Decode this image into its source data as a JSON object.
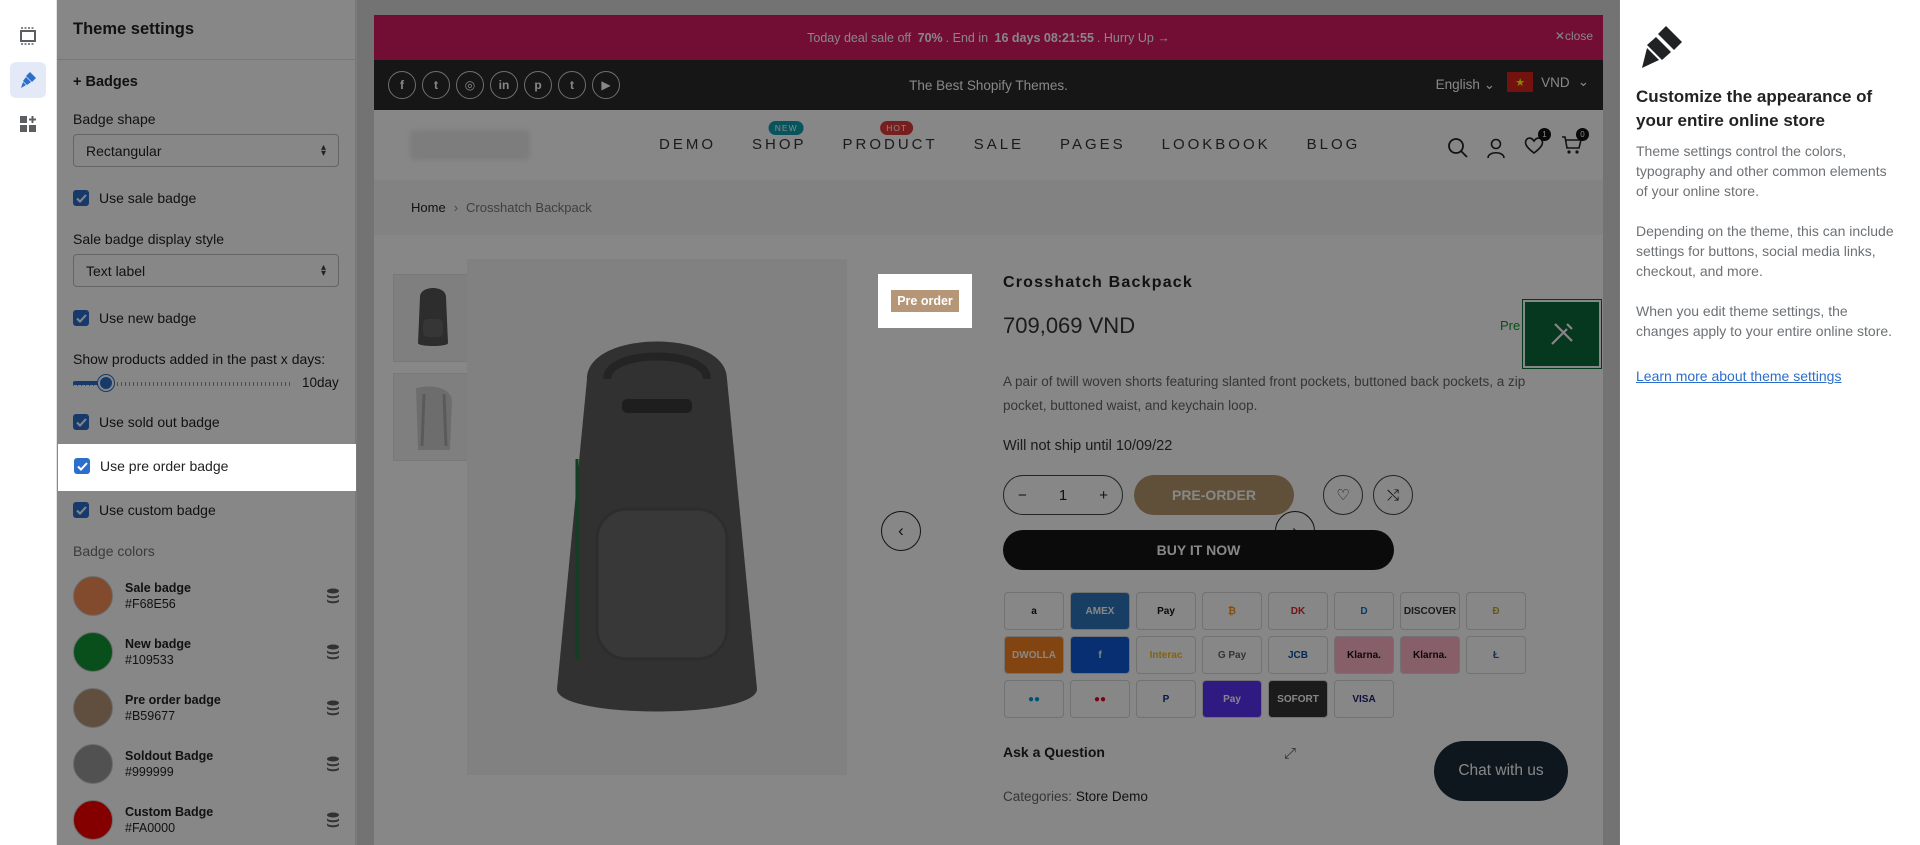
{
  "app": {
    "colors": {
      "accent": "#2c6ecb",
      "promo": "#d81b60",
      "topbar": "#2b2b2b",
      "pre_order": "#b59677",
      "help_link": "#2c6ecb"
    }
  },
  "rail": {
    "icons": [
      "sections-icon",
      "brush-icon",
      "apps-icon"
    ]
  },
  "settings": {
    "title": "Theme settings",
    "section": "+ Badges",
    "badge_shape_label": "Badge shape",
    "badge_shape_value": "Rectangular",
    "use_sale_badge": "Use sale badge",
    "sale_display_label": "Sale badge display style",
    "sale_display_value": "Text label",
    "use_new_badge": "Use new badge",
    "new_days_label": "Show products added in the past x days:",
    "new_days_value": "10day",
    "new_days_slider_fraction": 0.15,
    "use_sold_out_badge": "Use sold out badge",
    "use_pre_order_badge": "Use pre order badge",
    "use_custom_badge": "Use custom badge",
    "colors_heading": "Badge colors",
    "colors": [
      {
        "name": "Sale badge",
        "hex": "#F68E56",
        "swatch": "#F68E56"
      },
      {
        "name": "New badge",
        "hex": "#109533",
        "swatch": "#109533"
      },
      {
        "name": "Pre order badge",
        "hex": "#B59677",
        "swatch": "#B59677"
      },
      {
        "name": "Soldout Badge",
        "hex": "#999999",
        "swatch": "#999999"
      },
      {
        "name": "Custom Badge",
        "hex": "#FA0000",
        "swatch": "#FA0000"
      }
    ]
  },
  "store": {
    "promo": {
      "prefix": "Today deal sale off",
      "pct": "70%",
      "mid": ". End in",
      "countdown": "16 days 08:21:55",
      "suffix": ". Hurry Up →",
      "close": "close"
    },
    "topbar": {
      "tagline": "The Best Shopify Themes.",
      "language": "English",
      "currency": "VND",
      "social": [
        "f",
        "t",
        "◎",
        "in",
        "p",
        "t",
        "▶"
      ]
    },
    "nav": [
      {
        "label": "DEMO"
      },
      {
        "label": "SHOP",
        "badge": "NEW",
        "badge_color": "#109fb0"
      },
      {
        "label": "PRODUCT",
        "badge": "HOT",
        "badge_color": "#e03b3b"
      },
      {
        "label": "SALE"
      },
      {
        "label": "PAGES"
      },
      {
        "label": "LOOKBOOK"
      },
      {
        "label": "BLOG"
      }
    ],
    "wishlist_count": "1",
    "cart_count": "0",
    "breadcrumb": {
      "home": "Home",
      "current": "Crosshatch Backpack"
    },
    "product": {
      "badge": "Pre order",
      "title": "Crosshatch Backpack",
      "price": "709,069 VND",
      "pre_mini": "Pre",
      "description": "A pair of twill woven shorts featuring slanted front pockets, buttoned back pockets, a zip pocket, buttoned waist, and keychain loop.",
      "ship_note": "Will not ship until 10/09/22",
      "qty": "1",
      "pre_order_btn": "PRE-ORDER",
      "buy_now_btn": "BUY IT NOW",
      "ask": "Ask a Question",
      "categories_label": "Categories:",
      "categories_value": "Store Demo"
    },
    "payments": [
      {
        "label": "a",
        "bg": "#ffffff",
        "fg": "#111111"
      },
      {
        "label": "AMEX",
        "bg": "#2e77bb",
        "fg": "#ffffff"
      },
      {
        "label": " Pay",
        "bg": "#ffffff",
        "fg": "#111111"
      },
      {
        "label": "₿",
        "bg": "#ffffff",
        "fg": "#f7931a"
      },
      {
        "label": "DK",
        "bg": "#ffffff",
        "fg": "#e0242c"
      },
      {
        "label": "D",
        "bg": "#ffffff",
        "fg": "#0079be"
      },
      {
        "label": "DISCOVER",
        "bg": "#ffffff",
        "fg": "#333333"
      },
      {
        "label": "Ð",
        "bg": "#ffffff",
        "fg": "#c2a633"
      },
      {
        "label": "DWOLLA",
        "bg": "#f58220",
        "fg": "#ffffff"
      },
      {
        "label": "f",
        "bg": "#0f5ad6",
        "fg": "#ffffff"
      },
      {
        "label": "Interac",
        "bg": "#ffffff",
        "fg": "#fdb913"
      },
      {
        "label": "G Pay",
        "bg": "#ffffff",
        "fg": "#5f6368"
      },
      {
        "label": "JCB",
        "bg": "#ffffff",
        "fg": "#0b4ea2"
      },
      {
        "label": "Klarna.",
        "bg": "#ffb3c7",
        "fg": "#111111"
      },
      {
        "label": "Klarna.",
        "bg": "#ffb3c7",
        "fg": "#111111"
      },
      {
        "label": "Ł",
        "bg": "#ffffff",
        "fg": "#345d9d"
      },
      {
        "label": "●●",
        "bg": "#ffffff",
        "fg": "#0099df"
      },
      {
        "label": "●●",
        "bg": "#ffffff",
        "fg": "#eb001b"
      },
      {
        "label": "P",
        "bg": "#ffffff",
        "fg": "#003087"
      },
      {
        "label": "Pay",
        "bg": "#5a31f4",
        "fg": "#ffffff"
      },
      {
        "label": "SOFORT",
        "bg": "#333333",
        "fg": "#ffffff"
      },
      {
        "label": "VISA",
        "bg": "#ffffff",
        "fg": "#1a1f71"
      }
    ],
    "chat": "Chat with us"
  },
  "help": {
    "title": "Customize the appearance of your entire online store",
    "p1": "Theme settings control the colors, typography and other common elements of your online store.",
    "p2": "Depending on the theme, this can include settings for buttons, social media links, checkout, and more.",
    "p3": "When you edit theme settings, the changes apply to your entire online store.",
    "link": "Learn more about theme settings"
  }
}
